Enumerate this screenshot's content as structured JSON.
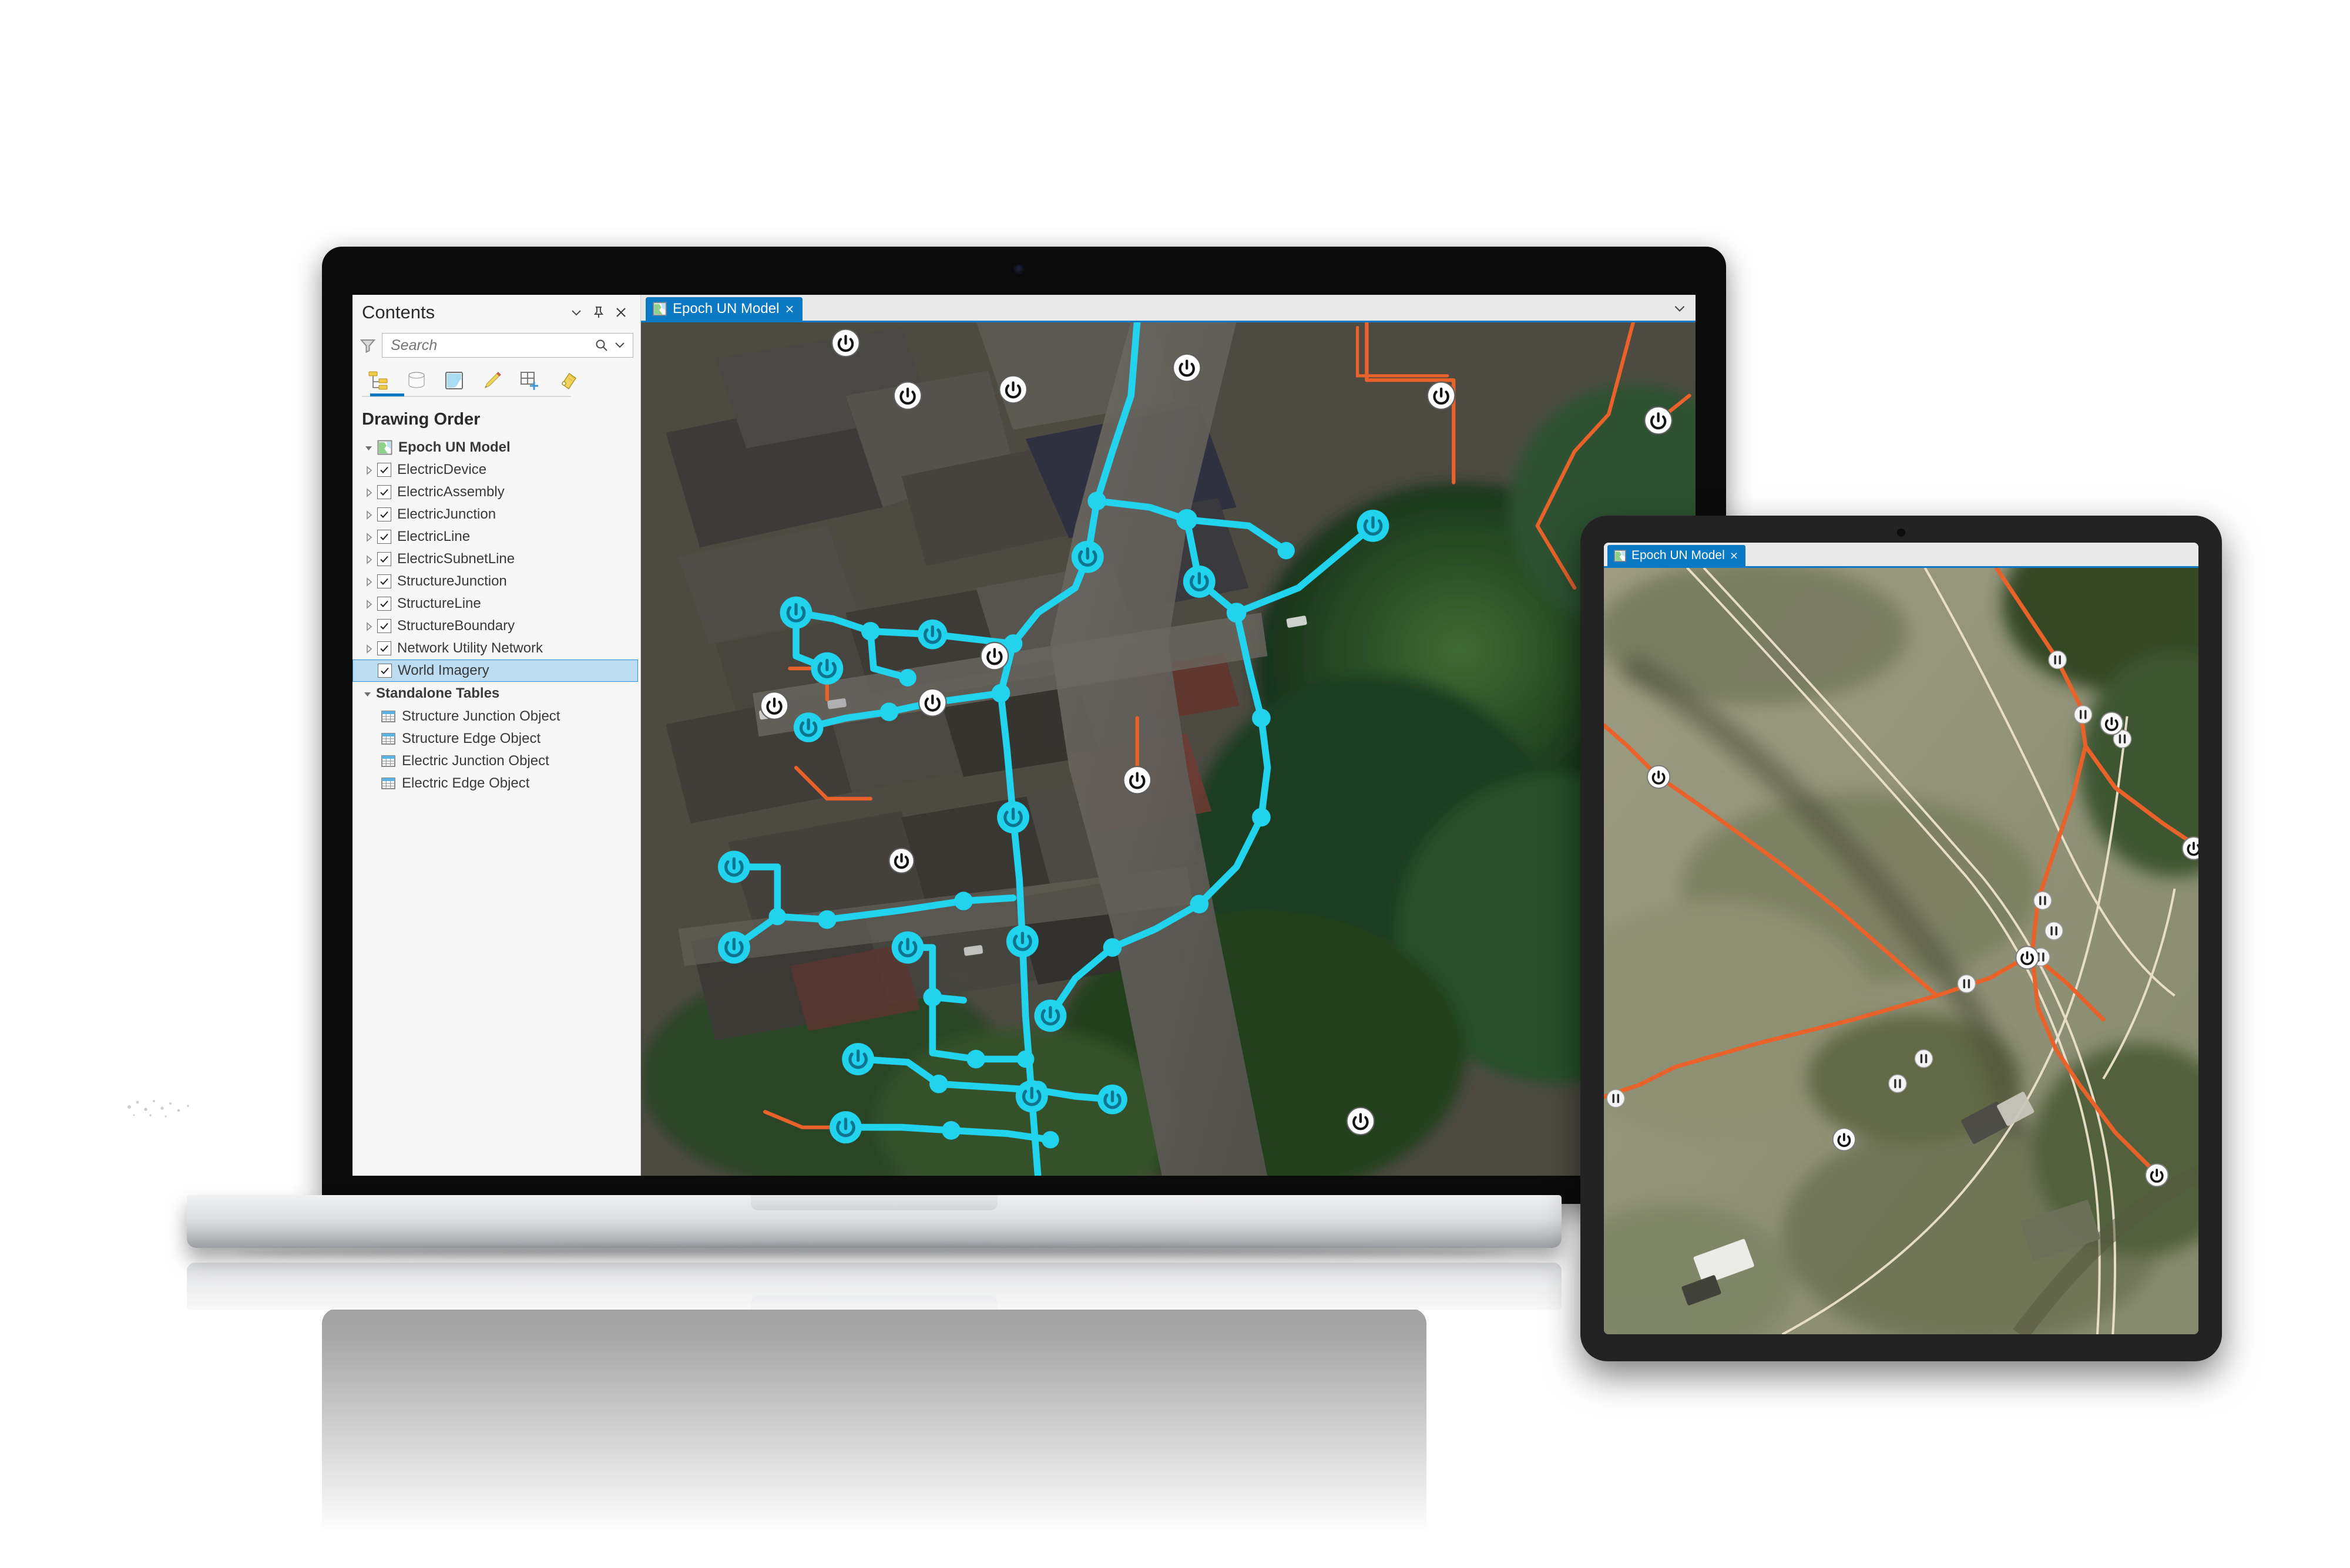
{
  "app": {
    "contents_panel": {
      "title": "Contents",
      "header_buttons": [
        {
          "name": "menu-chevron",
          "glyph": "chevron-down"
        },
        {
          "name": "auto-hide-pin",
          "glyph": "pin"
        },
        {
          "name": "close",
          "glyph": "close"
        }
      ],
      "search": {
        "placeholder": "Search",
        "value": "",
        "filter_icon": "filter-icon",
        "submit_icon": "search-icon",
        "options_icon": "chevron-down-icon"
      },
      "toolbar": [
        {
          "name": "drawing-order",
          "label": "List By Drawing Order",
          "active": true
        },
        {
          "name": "data-source",
          "label": "List By Data Source",
          "active": false
        },
        {
          "name": "selection",
          "label": "List By Selection",
          "active": false
        },
        {
          "name": "editing",
          "label": "List By Editing",
          "active": false
        },
        {
          "name": "snapping",
          "label": "List By Snapping",
          "active": false
        },
        {
          "name": "labeling",
          "label": "List By Labeling",
          "active": false
        }
      ],
      "section_title": "Drawing Order",
      "root": {
        "label": "Epoch UN Model",
        "expanded": true
      },
      "layers": [
        {
          "label": "ElectricDevice",
          "checked": true,
          "selected": false,
          "expandable": true
        },
        {
          "label": "ElectricAssembly",
          "checked": true,
          "selected": false,
          "expandable": true
        },
        {
          "label": "ElectricJunction",
          "checked": true,
          "selected": false,
          "expandable": true
        },
        {
          "label": "ElectricLine",
          "checked": true,
          "selected": false,
          "expandable": true
        },
        {
          "label": "ElectricSubnetLine",
          "checked": true,
          "selected": false,
          "expandable": true
        },
        {
          "label": "StructureJunction",
          "checked": true,
          "selected": false,
          "expandable": true
        },
        {
          "label": "StructureLine",
          "checked": true,
          "selected": false,
          "expandable": true
        },
        {
          "label": "StructureBoundary",
          "checked": true,
          "selected": false,
          "expandable": true
        },
        {
          "label": "Network Utility Network",
          "checked": true,
          "selected": false,
          "expandable": true
        },
        {
          "label": "World Imagery",
          "checked": true,
          "selected": true,
          "expandable": false
        }
      ],
      "standalone_tables": {
        "title": "Standalone Tables",
        "items": [
          {
            "label": "Structure Junction Object"
          },
          {
            "label": "Structure Edge Object"
          },
          {
            "label": "Electric Junction Object"
          },
          {
            "label": "Electric Edge Object"
          }
        ]
      }
    },
    "map_view": {
      "tab": {
        "label": "Epoch UN Model",
        "close_glyph": "×",
        "icon": "map-icon",
        "active": true
      },
      "overflow_icon": "chevron-down-icon",
      "basemap": "World Imagery"
    }
  },
  "tablet": {
    "tab": {
      "label": "Epoch UN Model",
      "close_glyph": "×",
      "icon": "map-icon",
      "active": true
    },
    "basemap": "World Imagery"
  },
  "colors": {
    "accent_blue": "#0b79c4",
    "selection_fill": "#bcdcf2",
    "selection_border": "#2f8fd6",
    "electric_cyan": "#22d3ee",
    "structure_orange": "#e8622a",
    "panel_bg": "#f7f7f7",
    "tabstrip_bg": "#e9e9e9",
    "bezel_black": "#0b0b0c",
    "tablet_bezel": "#232324",
    "laptop_base": "#dddee0"
  }
}
